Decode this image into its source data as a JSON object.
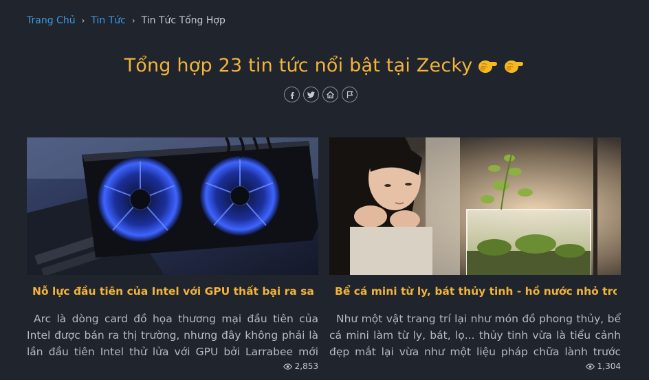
{
  "breadcrumb": {
    "home": "Trang Chủ",
    "news": "Tin Tức",
    "current": "Tin Tức Tổng Hợp",
    "separator": "›"
  },
  "page": {
    "title": "Tổng hợp 23 tin tức nổi bật tại Zecky"
  },
  "share_icons": [
    "facebook-icon",
    "twitter-icon",
    "home-icon",
    "flag-icon"
  ],
  "articles": [
    {
      "title": "Nỗ lực đầu tiên của Intel với GPU thất bại ra sao?",
      "description": "Arc là dòng card đồ họa thương mại đầu tiên của Intel được bán ra thị trường, nhưng đây không phải là lần đầu tiên Intel thử lửa với GPU bởi Larrabee mới thực sự là ...",
      "views": "2,853",
      "image": "gpu-graphics-card"
    },
    {
      "title": "Bể cá mini từ ly, bát thủy tinh - hồ nước nhỏ trong...",
      "description": "Như một vật trang trí lại như món đồ phong thủy, bể cá mini làm từ ly, bát, lọ... thủy tinh vừa là tiểu cảnh đẹp mắt lại vừa như một liệu pháp chữa lành trước những ...",
      "views": "1,304",
      "image": "girl-with-mini-aquarium"
    }
  ],
  "colors": {
    "background": "#1f242d",
    "accent": "#f2b43a",
    "link": "#3f9ae6"
  }
}
